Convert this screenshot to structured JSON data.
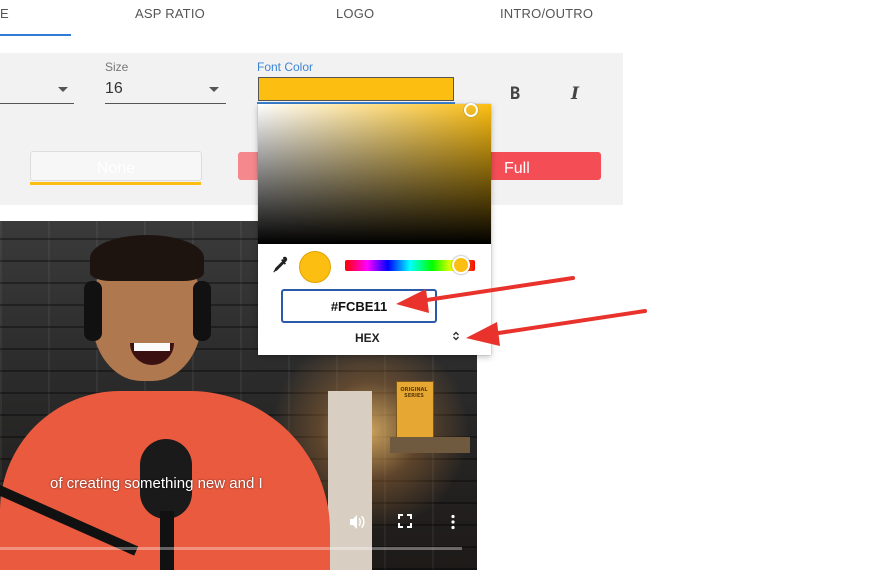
{
  "tabs": [
    {
      "label": "E"
    },
    {
      "label": "ASP RATIO"
    },
    {
      "label": "LOGO"
    },
    {
      "label": "INTRO/OUTRO"
    }
  ],
  "panel": {
    "size_label": "Size",
    "size_value": "16",
    "font_color_label": "Font Color",
    "font_color_value": "#FCBE11",
    "bold_label": "B",
    "italic_label": "I",
    "background_options": {
      "none_label": "None",
      "full_label": "Full"
    }
  },
  "color_picker": {
    "hex_value": "#FCBE11",
    "mode_label": "HEX",
    "mode_toggle_icon": "up-down-chevron-icon",
    "eyedropper_icon": "eyedropper-icon",
    "hue_position": 0.88
  },
  "video": {
    "caption": "of creating something new and I",
    "book_title": "ORIGINAL SERIES",
    "progress": 0.0
  },
  "colors": {
    "accent": "#2f7bd8",
    "font_color": "#FCBE11",
    "full_red": "#f44d55",
    "arrow_red": "#e8322b"
  }
}
